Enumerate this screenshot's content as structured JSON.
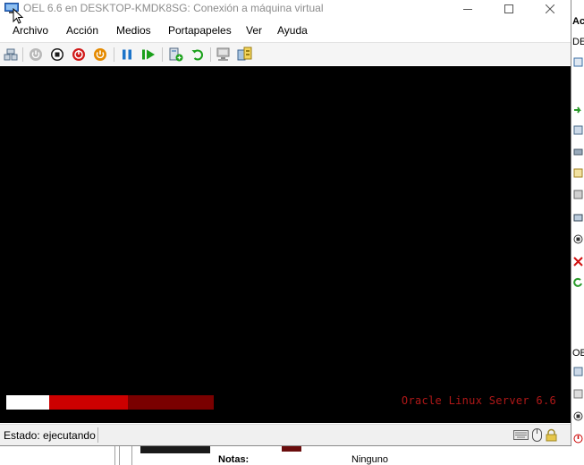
{
  "window": {
    "title": "OEL 6.6 en DESKTOP-KMDK8SG: Conexión a máquina virtual",
    "controls": [
      "minimize",
      "maximize",
      "close"
    ]
  },
  "menu": {
    "items": [
      "Archivo",
      "Acción",
      "Medios",
      "Portapapeles",
      "Ver",
      "Ayuda"
    ]
  },
  "toolbar": {
    "icons": [
      "ctrl-alt-del-icon",
      "start-icon",
      "turn-off-icon",
      "shut-down-icon",
      "save-icon",
      "pause-icon",
      "resume-icon",
      "checkpoint-icon",
      "revert-icon",
      "enhanced-session-icon",
      "share-icon"
    ]
  },
  "screen": {
    "boot_text": "Oracle Linux Server 6.6",
    "boot_progress": 0.21
  },
  "status": {
    "text": "Estado: ejecutando"
  },
  "background": {
    "right_labels": [
      "Acci",
      "DES",
      "OEL"
    ],
    "notes_label": "Notas:",
    "notes_value": "Ninguno"
  },
  "colors": {
    "screen_bg": "#000000",
    "progress_white": "#ffffff",
    "progress_red": "#cc0000",
    "progress_dark_red": "#7a0000",
    "boot_text": "#b01818"
  }
}
